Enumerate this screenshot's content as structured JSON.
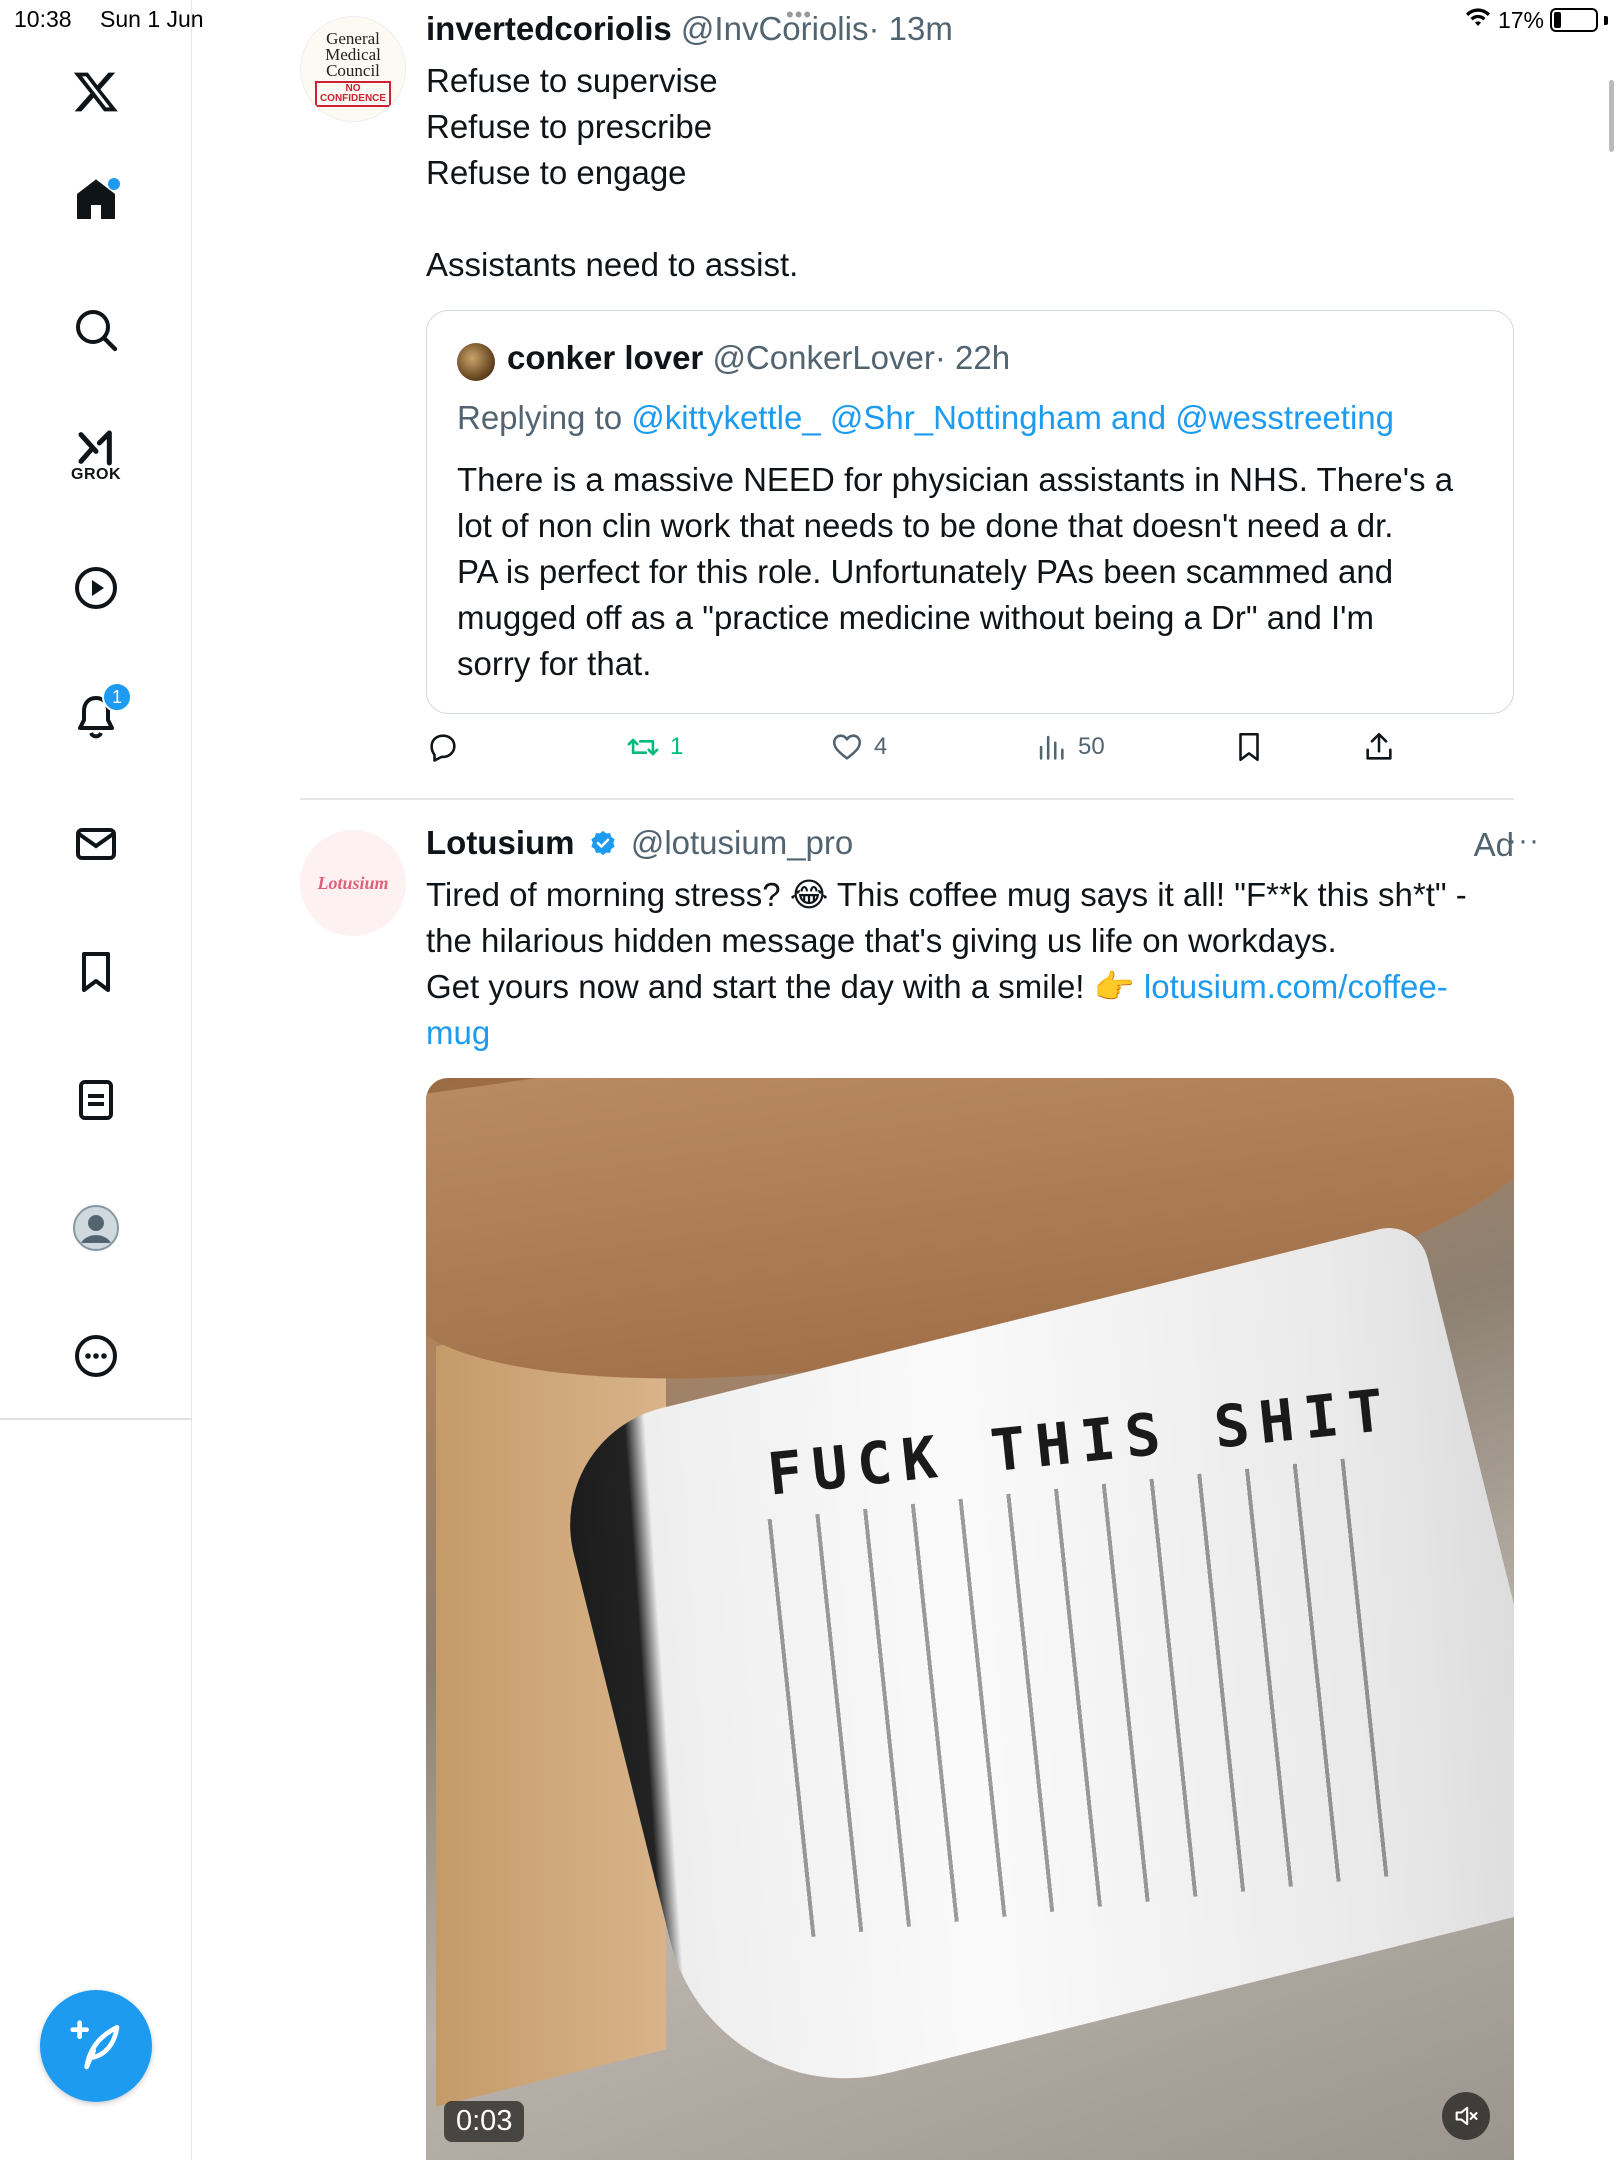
{
  "status_bar": {
    "time": "10:38",
    "date": "Sun 1 Jun",
    "dots": "•••",
    "battery": "17%",
    "battery_level": 0.17
  },
  "sidebar": {
    "logo_icon": "x-logo-icon",
    "items": [
      {
        "name": "home",
        "icon": "home-icon",
        "has_dot": true
      },
      {
        "name": "explore",
        "icon": "search-icon"
      },
      {
        "name": "grok",
        "icon": "grok-icon",
        "label": "GROK"
      },
      {
        "name": "videos",
        "icon": "play-icon"
      },
      {
        "name": "notifications",
        "icon": "bell-icon",
        "badge": "1"
      },
      {
        "name": "messages",
        "icon": "mail-icon"
      },
      {
        "name": "bookmarks",
        "icon": "bookmark-icon"
      },
      {
        "name": "lists",
        "icon": "list-icon"
      },
      {
        "name": "profile",
        "icon": "avatar-icon"
      },
      {
        "name": "more",
        "icon": "more-circle-icon"
      }
    ],
    "compose_icon": "compose-icon"
  },
  "tweet1": {
    "author": "invertedcoriolis",
    "handle": "@InvCoriolis",
    "time": "· 13m",
    "avatar": {
      "line1": "General",
      "line2": "Medical",
      "line3": "Council",
      "stamp1": "NO",
      "stamp2": "CONFIDENCE"
    },
    "lines": [
      "Refuse to supervise",
      "Refuse to prescribe",
      "Refuse to engage",
      "Assistants need to assist."
    ],
    "quote": {
      "author": "conker lover",
      "handle": "@ConkerLover",
      "time": "· 22h",
      "replying_prefix": "Replying to",
      "replying_to1": "@kittykettle_",
      "replying_to2": "@Shr_Nottingham",
      "replying_and": "and",
      "replying_to3": "@wesstreeting",
      "text_lines": [
        "There is a massive NEED for physician assistants in NHS. There's a",
        "lot of non clin work that needs to be done that doesn't need a dr.",
        "PA is perfect for this role. Unfortunately PAs been scammed and",
        "mugged off as a \"practice medicine without being a Dr\" and I'm",
        "sorry for that."
      ]
    },
    "actions": {
      "reply_count": "",
      "retweet_count": "1",
      "like_count": "4",
      "view_count": "50"
    },
    "retweet_color": "#00ba7c"
  },
  "tweet2": {
    "author": "Lotusium",
    "handle": "@lotusium_pro",
    "ad_label": "Ad",
    "more": "···",
    "avatar_text": "Lotusium",
    "text_line1": "Tired of morning stress? 😂 This coffee mug says it all! \"F**k this sh*t\" -",
    "text_line2": "the hilarious hidden message that's giving us life on workdays.",
    "text_line3_prefix": "Get yours now and start the day with a smile! 👉 ",
    "link_part1": "lotusium.com/coffee-",
    "link_part2": "mug",
    "video": {
      "duration": "0:03",
      "mug_text": "FUCK THIS SHIT"
    }
  },
  "colors": {
    "accent": "#1d9bf0",
    "text": "#0f1419",
    "secondary": "#536471",
    "border": "#cfd9de"
  }
}
